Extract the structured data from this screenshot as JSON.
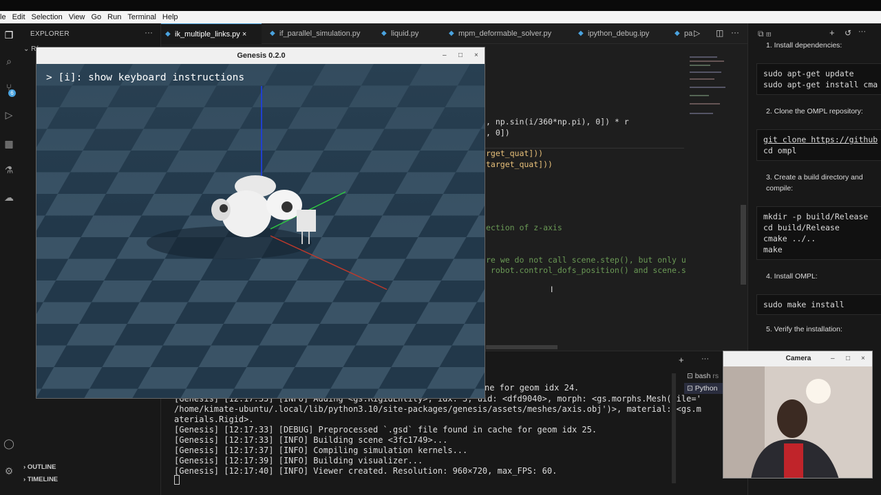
{
  "menu": [
    "le",
    "Edit",
    "Selection",
    "View",
    "Go",
    "Run",
    "Terminal",
    "Help"
  ],
  "sidebar": {
    "title": "EXPLORER",
    "more": "···",
    "root_label": "R(",
    "outline": "OUTLINE",
    "timeline": "TIMELINE",
    "badge": "6"
  },
  "tabs": [
    {
      "label": "ik_multiple_links.py",
      "close": "×",
      "active": true
    },
    {
      "label": "if_parallel_simulation.py"
    },
    {
      "label": "liquid.py"
    },
    {
      "label": "mpm_deformable_solver.py"
    },
    {
      "label": "ipython_debug.ipy"
    },
    {
      "label": "pa"
    }
  ],
  "code": [
    {
      "text": ", np.sin(i/360*np.pi), 0]) * r"
    },
    {
      "text": ", 0])"
    },
    {
      "text": "rget_quat]))"
    },
    {
      "text": "target_quat]))"
    },
    {
      "text": "ection of z-axis"
    },
    {
      "text": "re we do not call scene.step(), but only up"
    },
    {
      "text": " robot.control_dofs_position() and scene.st"
    }
  ],
  "terminal": {
    "partial": "ne for geom idx 24.",
    "lines": [
      "[Genesis] [12:17:33] [INFO] Adding <gs.RigidEntity>, idx: 3, uid: <dfd9040>, morph: <gs.morphs.Mesh(file='",
      "/home/kimate-ubuntu/.local/lib/python3.10/site-packages/genesis/assets/meshes/axis.obj')>, material: <gs.m",
      "aterials.Rigid>.",
      "[Genesis] [12:17:33] [DEBUG] Preprocessed `.gsd` file found in cache for geom idx 25.",
      "[Genesis] [12:17:33] [INFO] Building scene <3fc1749>...",
      "[Genesis] [12:17:37] [INFO] Compiling simulation kernels...",
      "[Genesis] [12:17:39] [INFO] Building visualizer...",
      "[Genesis] [12:17:40] [INFO] Viewer created. Resolution: 960×720, max_FPS: 60."
    ],
    "sessions": [
      "bash",
      "Python"
    ],
    "bash_suffix": "rs"
  },
  "chat": {
    "steps": [
      "1. Install dependencies:",
      "2. Clone the OMPL repository:",
      "3. Create a build directory and",
      "compile:",
      "4. Install OMPL:",
      "5. Verify the installation:"
    ],
    "blocks": [
      [
        "sudo apt-get update",
        "sudo apt-get install cma"
      ],
      [
        "git clone https://github",
        "cd ompl"
      ],
      [
        "mkdir -p build/Release",
        "cd build/Release",
        "cmake ../..",
        "make"
      ],
      [
        "sudo make install"
      ]
    ]
  },
  "genesis": {
    "title": "Genesis 0.2.0",
    "overlay": "> [i]: show keyboard instructions"
  },
  "camera": {
    "title": "Camera"
  },
  "window_buttons": {
    "min": "–",
    "max": "□",
    "close": "×"
  },
  "colors": {
    "accent": "#4aa3df",
    "floor_dark": "#22384a",
    "floor_light": "#3a5366",
    "axis_x": "#c0392b",
    "axis_y": "#2ecc40",
    "axis_z": "#2040d0"
  }
}
